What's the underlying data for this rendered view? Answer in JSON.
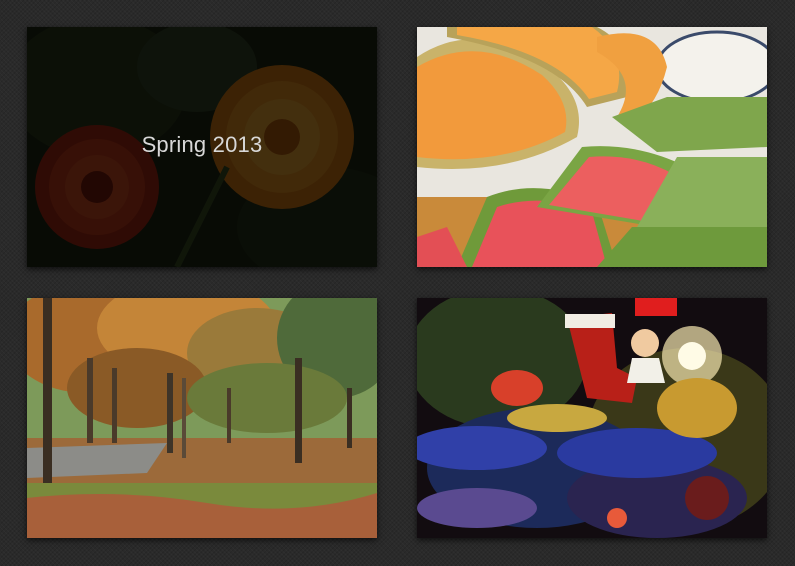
{
  "gallery": {
    "items": [
      {
        "caption": "Spring 2013",
        "image": "flowers-photo",
        "state": "hovered"
      },
      {
        "caption": "",
        "image": "melon-slices-photo"
      },
      {
        "caption": "",
        "image": "autumn-park-photo"
      },
      {
        "caption": "",
        "image": "christmas-tree-photo"
      }
    ]
  }
}
